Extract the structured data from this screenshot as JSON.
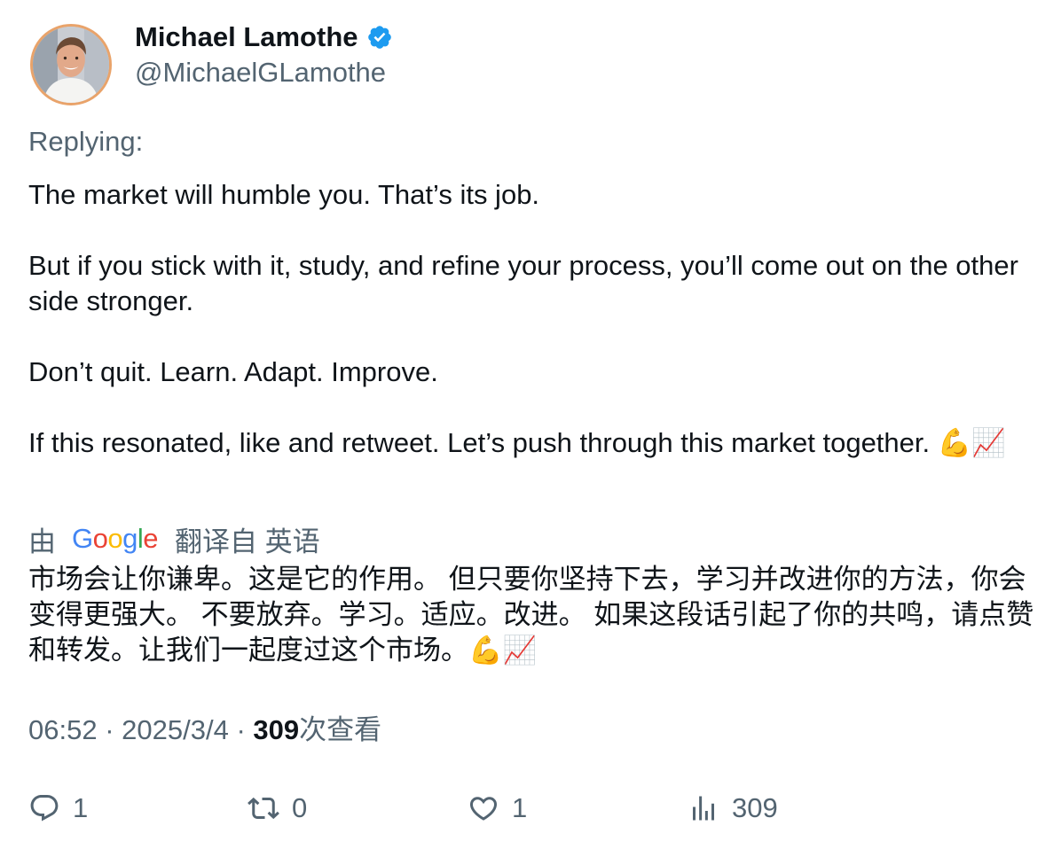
{
  "author": {
    "display_name": "Michael Lamothe",
    "handle": "@MichaelGLamothe",
    "verified": true
  },
  "replying_label": "Replying:",
  "tweet": {
    "paragraphs": [
      "The market will humble you. That’s its job.",
      "But if you stick with it, study, and refine your process, you’ll come out on the other side stronger.",
      "Don’t quit. Learn. Adapt. Improve.",
      "If this resonated, like and retweet. Let’s push through this market together. 💪📈"
    ]
  },
  "translation": {
    "prefix": "由",
    "provider": "Google",
    "suffix": "翻译自 英语",
    "text": "市场会让你谦卑。这是它的作用。 但只要你坚持下去，学习并改进你的方法，你会变得更强大。 不要放弃。学习。适应。改进。 如果这段话引起了你的共鸣，请点赞和转发。让我们一起度过这个市场。💪📈"
  },
  "meta": {
    "time": "06:52",
    "separator": "·",
    "date": "2025/3/4",
    "views_count": "309",
    "views_label": "次查看"
  },
  "actions": {
    "reply_count": "1",
    "retweet_count": "0",
    "like_count": "1",
    "views_count": "309"
  },
  "colors": {
    "text_primary": "#0f1419",
    "text_secondary": "#536471",
    "verified_blue": "#1d9bf0",
    "google_blue": "#4285F4",
    "google_red": "#EA4335",
    "google_yellow": "#FBBC05",
    "google_green": "#34A853"
  },
  "icons": {
    "verified": "verified-badge-icon",
    "reply": "reply-bubble-icon",
    "retweet": "retweet-icon",
    "like": "heart-icon",
    "views": "bar-chart-icon"
  }
}
